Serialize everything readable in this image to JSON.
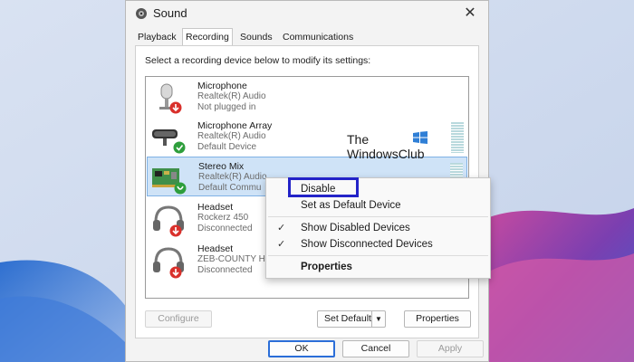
{
  "window": {
    "title": "Sound",
    "close_icon": "close-icon",
    "app_icon": "speaker-icon"
  },
  "tabs": [
    {
      "label": "Playback",
      "active": false
    },
    {
      "label": "Recording",
      "active": true
    },
    {
      "label": "Sounds",
      "active": false
    },
    {
      "label": "Communications",
      "active": false
    }
  ],
  "instruction": "Select a recording device below to modify its settings:",
  "devices": [
    {
      "name": "Microphone",
      "driver": "Realtek(R) Audio",
      "status": "Not plugged in",
      "icon": "microphone-icon",
      "badge": "red-down-arrow"
    },
    {
      "name": "Microphone Array",
      "driver": "Realtek(R) Audio",
      "status": "Default Device",
      "icon": "microphone-array-icon",
      "badge": "green-check"
    },
    {
      "name": "Stereo Mix",
      "driver": "Realtek(R) Audio",
      "status": "Default Commu",
      "icon": "sound-card-icon",
      "badge": "green-phone",
      "selected": true
    },
    {
      "name": "Headset",
      "driver": "Rockerz 450",
      "status": "Disconnected",
      "icon": "headset-icon",
      "badge": "red-down-arrow"
    },
    {
      "name": "Headset",
      "driver": "ZEB-COUNTY H",
      "status": "Disconnected",
      "icon": "headset-icon",
      "badge": "red-down-arrow"
    }
  ],
  "watermark": {
    "line1": "The",
    "line2": "WindowsClub"
  },
  "buttons": {
    "configure": "Configure",
    "set_default": "Set Default",
    "properties": "Properties",
    "ok": "OK",
    "cancel": "Cancel",
    "apply": "Apply"
  },
  "context_menu": {
    "items": [
      {
        "label": "Disable",
        "checked": false,
        "bold": false,
        "highlighted": true
      },
      {
        "label": "Set as Default Device",
        "checked": false,
        "bold": false
      },
      {
        "label": "Show Disabled Devices",
        "checked": true,
        "bold": false
      },
      {
        "label": "Show Disconnected Devices",
        "checked": true,
        "bold": false
      },
      {
        "label": "Properties",
        "checked": false,
        "bold": true
      }
    ],
    "check_glyph": "✓"
  },
  "colors": {
    "accent": "#2b6ed8",
    "highlight_box": "#2323c8",
    "selected_row": "#cfe3f7",
    "badge_red": "#d9302b",
    "badge_green": "#2e9e3c"
  }
}
